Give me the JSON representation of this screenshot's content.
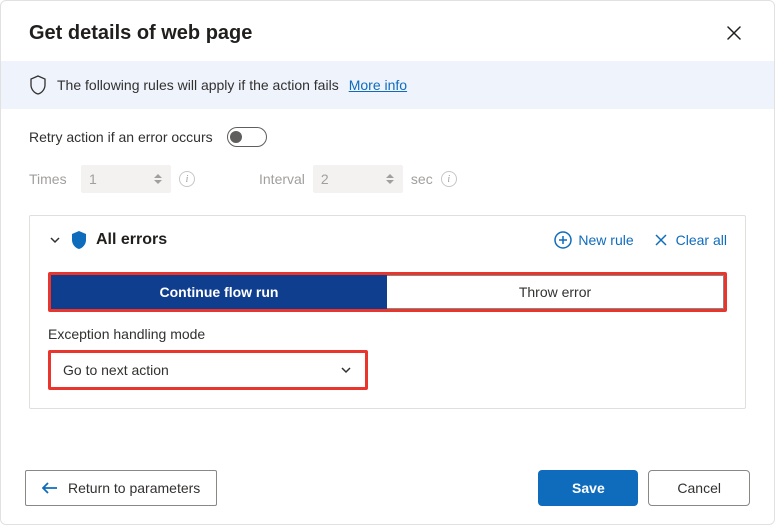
{
  "header": {
    "title": "Get details of web page"
  },
  "banner": {
    "text": "The following rules will apply if the action fails",
    "link_text": "More info"
  },
  "retry": {
    "label": "Retry action if an error occurs",
    "enabled": false,
    "times_label": "Times",
    "times_value": "1",
    "interval_label": "Interval",
    "interval_value": "2",
    "interval_unit": "sec"
  },
  "errors": {
    "title": "All errors",
    "new_rule_label": "New rule",
    "clear_all_label": "Clear all",
    "mode_continue": "Continue flow run",
    "mode_throw": "Throw error",
    "ehm_label": "Exception handling mode",
    "ehm_value": "Go to next action"
  },
  "footer": {
    "back_label": "Return to parameters",
    "save_label": "Save",
    "cancel_label": "Cancel"
  }
}
